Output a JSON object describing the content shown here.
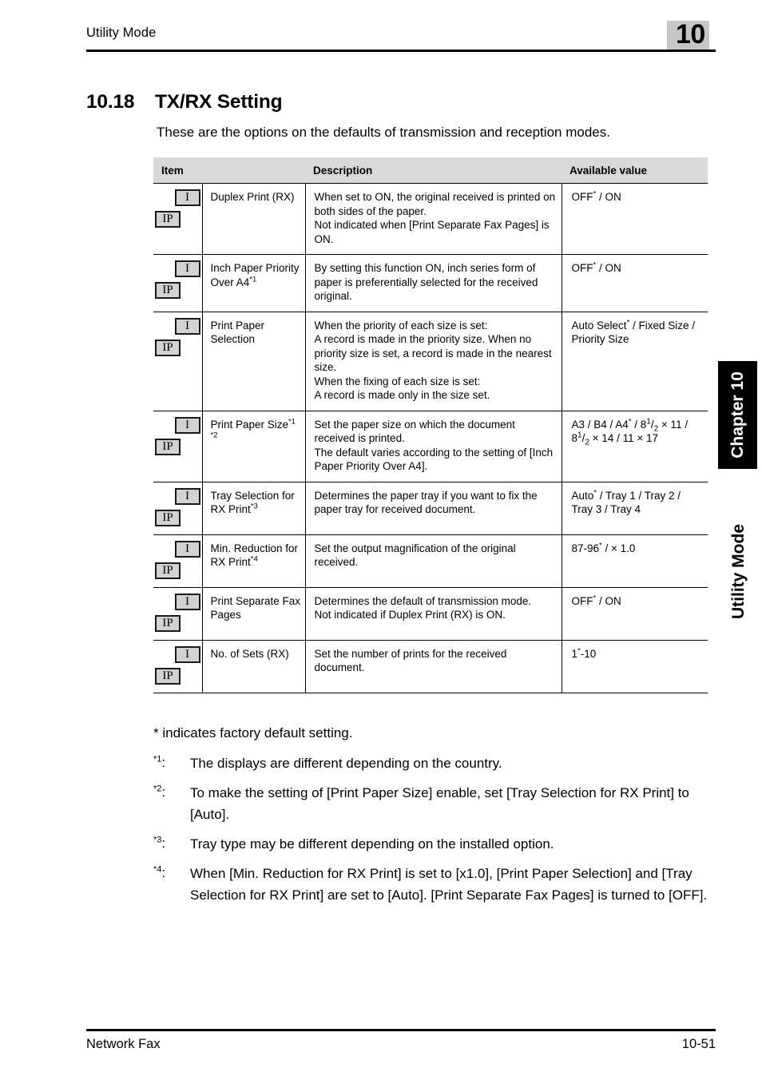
{
  "header": {
    "title": "Utility Mode",
    "chapter_number": "10"
  },
  "section": {
    "number": "10.18",
    "title": "TX/RX Setting",
    "intro": "These are the options on the defaults of transmission and reception modes."
  },
  "table": {
    "columns": [
      "Item",
      "Description",
      "Available value"
    ],
    "icons": {
      "first": "I",
      "second": "IP"
    },
    "rows": [
      {
        "item": "Duplex Print (RX)",
        "item_sup": "",
        "description": "When set to ON, the original received is printed on both sides of the paper.\nNot indicated when [Print Separate Fax Pages] is ON.",
        "value": "OFF* / ON"
      },
      {
        "item": "Inch Paper Priority Over A4",
        "item_sup": "*1",
        "description": "By setting this function ON, inch series form of paper is preferentially selected for the received original.",
        "value": "OFF* / ON"
      },
      {
        "item": "Print Paper Selection",
        "item_sup": "",
        "description": "When the priority of each size is set:\nA record is made in the priority size. When no priority size is set, a record is made in the nearest size.\nWhen the fixing of each size is set:\nA record is made only in the size set.",
        "value": "Auto Select* / Fixed Size / Priority Size"
      },
      {
        "item": "Print Paper Size",
        "item_sup": "*1 *2",
        "description": "Set the paper size on which the document received is printed.\nThe default varies according to the setting of [Inch Paper Priority Over A4].",
        "value": "A3 / B4 / A4* / 8 1/2 × 11 / 8 1/2 × 14 / 11 × 17"
      },
      {
        "item": "Tray Selection for RX Print",
        "item_sup": "*3",
        "description": "Determines the paper tray if you want to fix the paper tray for received document.",
        "value": "Auto* / Tray 1 / Tray 2 / Tray 3 / Tray 4"
      },
      {
        "item": "Min. Reduction for RX Print",
        "item_sup": "*4",
        "description": "Set the output magnification of the original received.",
        "value": "87-96* / × 1.0"
      },
      {
        "item": "Print Separate Fax Pages",
        "item_sup": "",
        "description": "Determines the default of transmission mode.\nNot indicated if Duplex Print (RX) is ON.",
        "value": "OFF* / ON"
      },
      {
        "item": "No. of Sets (RX)",
        "item_sup": "",
        "description": "Set the number of prints for the received document.",
        "value": "1*-10"
      }
    ]
  },
  "footnotes": {
    "default_note": "* indicates factory default setting.",
    "items": [
      {
        "marker": "*1",
        "text": "The displays are different depending on the country."
      },
      {
        "marker": "*2",
        "text": "To make the setting of [Print Paper Size] enable, set [Tray Selection for RX Print] to [Auto]."
      },
      {
        "marker": "*3",
        "text": "Tray type may be different depending on the installed option."
      },
      {
        "marker": "*4",
        "text": "When [Min. Reduction for RX Print] is set to [x1.0], [Print Paper Selection] and [Tray Selection for RX Print] are set to [Auto]. [Print Separate Fax Pages] is turned to [OFF]."
      }
    ]
  },
  "side_tabs": {
    "chapter": "Chapter 10",
    "mode": "Utility Mode"
  },
  "footer": {
    "left": "Network Fax",
    "page": "10-51"
  },
  "colors": {
    "header_chapter_bg": "#c6c6c6",
    "table_header_bg": "#d9d9d9",
    "icon_badge_bg": "#d2d2d2",
    "side_tab_bg": "#000000"
  }
}
